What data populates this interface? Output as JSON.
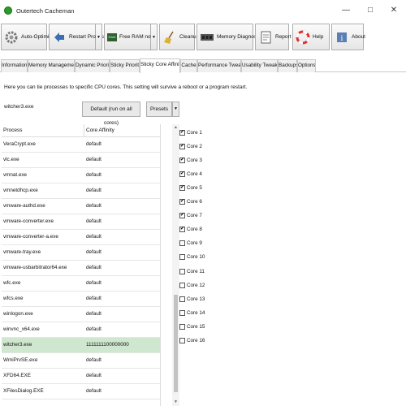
{
  "window": {
    "title": "Outertech Cacheman"
  },
  "toolbar": {
    "auto_optimize": "Auto-Optimize",
    "restart_process": "Restart Process",
    "free_ram": "Free RAM now!",
    "ram_badge": "RAM",
    "cleanup": "Cleanup",
    "memory_diagnostic": "Memory Diagnostic",
    "report": "Report",
    "help": "Help",
    "about": "About"
  },
  "tabs": [
    "Information",
    "Memory Management",
    "Dynamic Priority",
    "Sticky Priority",
    "Sticky Core Affinity",
    "Cache",
    "Performance Tweaks",
    "Usability Tweaks",
    "Backups",
    "Options"
  ],
  "active_tab": "Sticky Core Affinity",
  "panel": {
    "description": "Here you can tie processes to specific CPU cores. This setting will survive a reboot or a program restart.",
    "selected_process": "witcher3.exe",
    "default_button": "Default (run on all cores)",
    "presets_button": "Presets"
  },
  "table": {
    "headers": [
      "Process",
      "Core Affinity"
    ],
    "rows": [
      [
        "VeraCrypt.exe",
        "default"
      ],
      [
        "vlc.exe",
        "default"
      ],
      [
        "vmnat.exe",
        "default"
      ],
      [
        "vmnetdhcp.exe",
        "default"
      ],
      [
        "vmware-authd.exe",
        "default"
      ],
      [
        "vmware-converter.exe",
        "default"
      ],
      [
        "vmware-converter-a.exe",
        "default"
      ],
      [
        "vmware-tray.exe",
        "default"
      ],
      [
        "vmware-usbarbitrator64.exe",
        "default"
      ],
      [
        "wfc.exe",
        "default"
      ],
      [
        "wfcs.exe",
        "default"
      ],
      [
        "winlogon.exe",
        "default"
      ],
      [
        "winvnc_x64.exe",
        "default"
      ],
      [
        "witcher3.exe",
        "1111111100000000"
      ],
      [
        "WmiPrvSE.exe",
        "default"
      ],
      [
        "XFD64.EXE",
        "default"
      ],
      [
        "XFilesDialog.EXE",
        "default"
      ]
    ],
    "selected_index": 13
  },
  "cores": [
    {
      "label": "Core 1",
      "checked": true
    },
    {
      "label": "Core 2",
      "checked": true
    },
    {
      "label": "Core 3",
      "checked": true
    },
    {
      "label": "Core 4",
      "checked": true
    },
    {
      "label": "Core 5",
      "checked": true
    },
    {
      "label": "Core 6",
      "checked": true
    },
    {
      "label": "Core 7",
      "checked": true
    },
    {
      "label": "Core 8",
      "checked": true
    },
    {
      "label": "Core 9",
      "checked": false
    },
    {
      "label": "Core 10",
      "checked": false
    },
    {
      "label": "Core 11",
      "checked": false
    },
    {
      "label": "Core 12",
      "checked": false
    },
    {
      "label": "Core 13",
      "checked": false
    },
    {
      "label": "Core 14",
      "checked": false
    },
    {
      "label": "Core 15",
      "checked": false
    },
    {
      "label": "Core 16",
      "checked": false
    }
  ],
  "icons": {
    "app": "cacheman-logo-icon",
    "auto_optimize": "gear-icon",
    "restart": "arrows-icon",
    "free_ram": "ram-chip-icon",
    "cleanup": "broom-icon",
    "memory_diagnostic": "memory-module-icon",
    "report": "document-icon",
    "help": "lifebuoy-icon",
    "about": "info-book-icon"
  },
  "colors": {
    "selection": "#cfe6cf",
    "app_green": "#2a9b2a"
  }
}
